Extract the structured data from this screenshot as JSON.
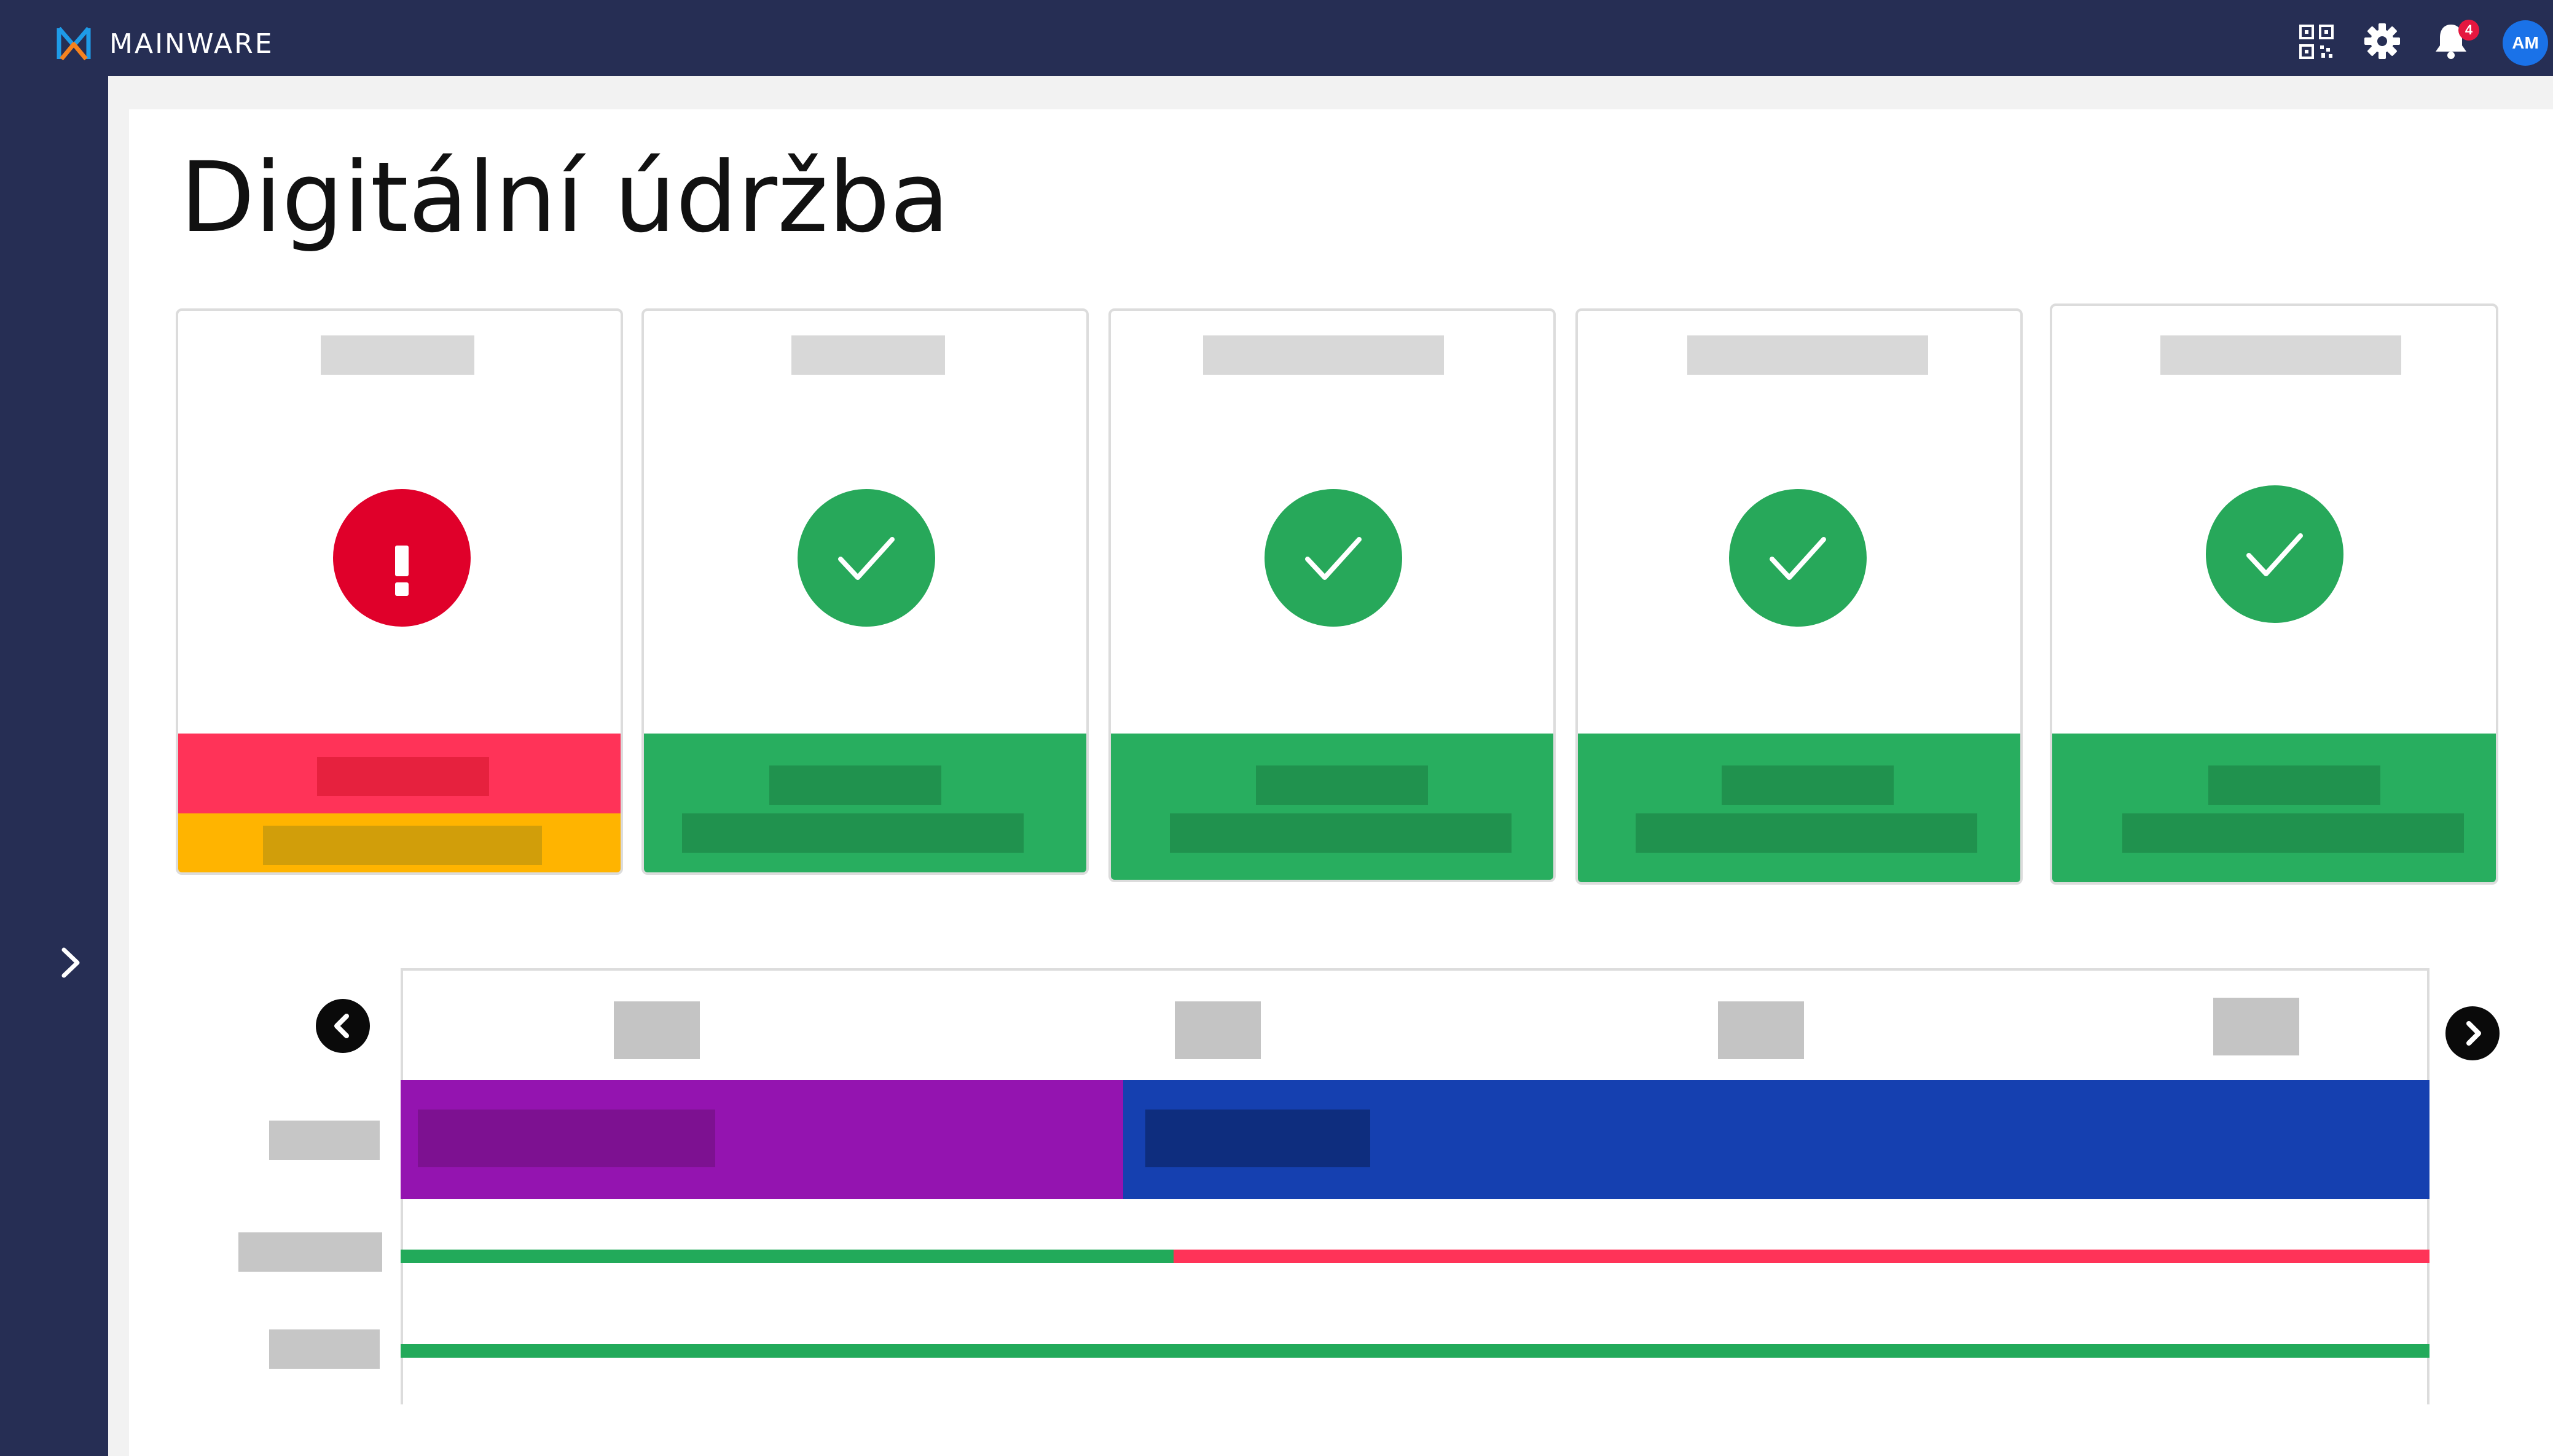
{
  "app": {
    "brand": "MAINWARE",
    "brand_colors": {
      "navy": "#262e54",
      "logo_blue": "#1e9be8",
      "logo_orange": "#f5821f"
    }
  },
  "header": {
    "icons": [
      "qr-code-icon",
      "gear-icon",
      "bell-icon"
    ],
    "notification_count": "4",
    "avatar_initials": "AM"
  },
  "sidebar": {
    "expand_icon": "chevron-right-icon"
  },
  "page": {
    "title": "Digitální údržba"
  },
  "status_cards": [
    {
      "status": "error",
      "icon": "exclamation-icon",
      "circle_color": "#e0002a",
      "footer_colors": [
        "#ff3358",
        "#ffb400"
      ]
    },
    {
      "status": "ok",
      "icon": "checkmark-icon",
      "circle_color": "#27a85a",
      "footer_colors": [
        "#28ae5f"
      ]
    },
    {
      "status": "ok",
      "icon": "checkmark-icon",
      "circle_color": "#27a85a",
      "footer_colors": [
        "#28ae5f"
      ]
    },
    {
      "status": "ok",
      "icon": "checkmark-icon",
      "circle_color": "#27a85a",
      "footer_colors": [
        "#28ae5f"
      ]
    },
    {
      "status": "ok",
      "icon": "checkmark-icon",
      "circle_color": "#27a85a",
      "footer_colors": [
        "#28ae5f"
      ]
    }
  ],
  "timeline": {
    "prev_icon": "chevron-left-icon",
    "next_icon": "chevron-right-icon",
    "date_count_visible": 4,
    "row_count": 3,
    "rows": [
      {
        "segments": [
          {
            "color": "#9414b0",
            "share": 0.356
          },
          {
            "color": "#1540b0",
            "share": 0.644
          }
        ]
      },
      {
        "segments": [
          {
            "color": "#22aa5a",
            "share": 0.381
          },
          {
            "color": "#ff3358",
            "share": 0.619
          }
        ]
      },
      {
        "segments": [
          {
            "color": "#22aa5a",
            "share": 1.0
          }
        ]
      }
    ]
  }
}
